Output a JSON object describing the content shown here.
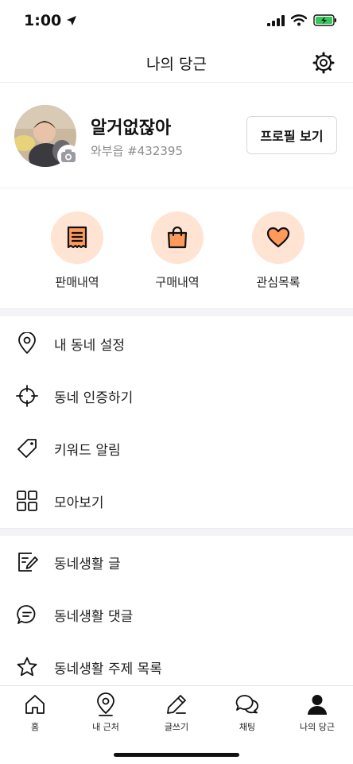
{
  "status": {
    "time": "1:00"
  },
  "header": {
    "title": "나의 당근"
  },
  "profile": {
    "name": "알거없잖아",
    "sub": "와부읍 #432395",
    "view_button": "프로필 보기"
  },
  "quick_actions": [
    {
      "label": "판매내역",
      "icon": "receipt-icon"
    },
    {
      "label": "구매내역",
      "icon": "shopping-bag-icon"
    },
    {
      "label": "관심목록",
      "icon": "heart-icon"
    }
  ],
  "menu_group_1": [
    {
      "label": "내 동네 설정",
      "icon": "location-pin-icon"
    },
    {
      "label": "동네 인증하기",
      "icon": "crosshair-icon"
    },
    {
      "label": "키워드 알림",
      "icon": "tag-icon"
    },
    {
      "label": "모아보기",
      "icon": "grid-icon"
    }
  ],
  "menu_group_2": [
    {
      "label": "동네생활 글",
      "icon": "edit-note-icon"
    },
    {
      "label": "동네생활 댓글",
      "icon": "chat-bubble-icon"
    },
    {
      "label": "동네생활 주제 목록",
      "icon": "star-icon"
    }
  ],
  "tabs": [
    {
      "label": "홈",
      "icon": "home-icon"
    },
    {
      "label": "내 근처",
      "icon": "nearby-pin-icon"
    },
    {
      "label": "글쓰기",
      "icon": "pencil-icon"
    },
    {
      "label": "채팅",
      "icon": "chat-icon"
    },
    {
      "label": "나의 당근",
      "icon": "person-icon",
      "active": true
    }
  ],
  "colors": {
    "accent_light": "#ffe4d4",
    "accent": "#ff7e36",
    "text": "#212124",
    "subtext": "#8b8b8f"
  }
}
